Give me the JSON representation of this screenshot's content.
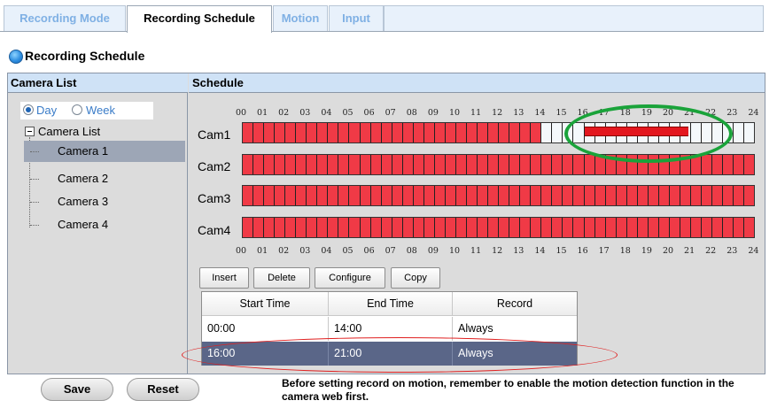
{
  "tabs": [
    {
      "label": "Recording Mode",
      "active": false
    },
    {
      "label": "Recording Schedule",
      "active": true
    },
    {
      "label": "Motion",
      "active": false
    },
    {
      "label": "Input",
      "active": false
    }
  ],
  "section_title": "Recording Schedule",
  "camera_list": {
    "header": "Camera List",
    "view_options": [
      {
        "label": "Day",
        "checked": true
      },
      {
        "label": "Week",
        "checked": false
      }
    ],
    "root_label": "Camera List",
    "cameras": [
      "Camera 1",
      "Camera 2",
      "Camera 3",
      "Camera 4"
    ],
    "selected": "Camera 1"
  },
  "schedule": {
    "header": "Schedule",
    "hours": [
      "00",
      "01",
      "02",
      "03",
      "04",
      "05",
      "06",
      "07",
      "08",
      "09",
      "10",
      "11",
      "12",
      "13",
      "14",
      "15",
      "16",
      "17",
      "18",
      "19",
      "20",
      "21",
      "22",
      "23",
      "24"
    ],
    "rows": [
      {
        "label": "Cam1",
        "note": "always 00:00-14:00, motion 16:00-21:00"
      },
      {
        "label": "Cam2",
        "note": "always all day"
      },
      {
        "label": "Cam3",
        "note": "always all day"
      },
      {
        "label": "Cam4",
        "note": "always all day"
      }
    ],
    "colors": {
      "always": "#f03a46",
      "motion": "#e3171f",
      "none": "#f4f8fb"
    }
  },
  "toolbar": {
    "insert": "Insert",
    "delete": "Delete",
    "configure": "Configure",
    "copy": "Copy"
  },
  "table": {
    "columns": [
      "Start Time",
      "End Time",
      "Record"
    ],
    "rows": [
      [
        "00:00",
        "14:00",
        "Always"
      ],
      [
        "16:00",
        "21:00",
        "Always"
      ]
    ],
    "selected_row": 1
  },
  "buttons": {
    "save": "Save",
    "reset": "Reset"
  },
  "note": "Before setting record on motion, remember to enable the motion detection function in the camera web first."
}
